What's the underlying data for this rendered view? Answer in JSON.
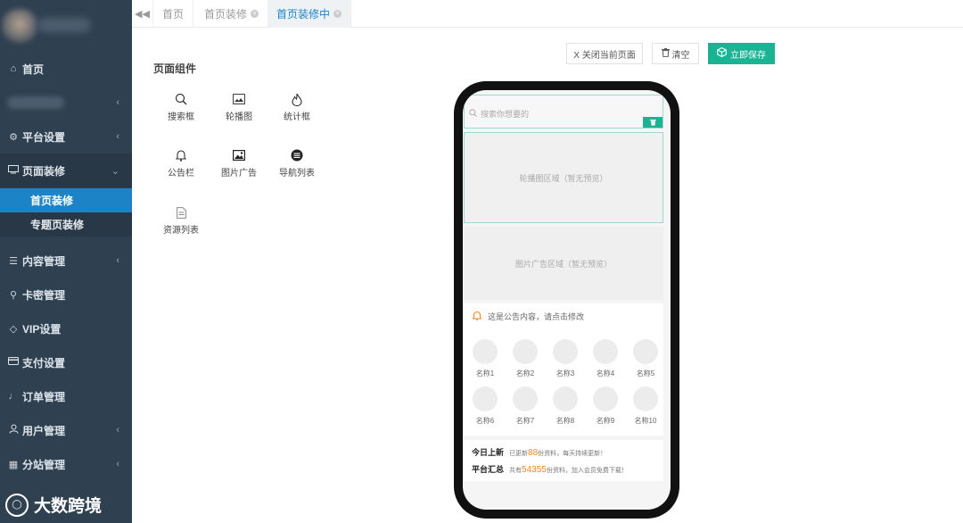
{
  "sidebar": {
    "items": [
      {
        "label": "首页",
        "icon": "home-icon"
      },
      {
        "label": "平台设置",
        "icon": "gear-icon"
      },
      {
        "label": "页面装修",
        "icon": "monitor-icon"
      },
      {
        "label": "内容管理",
        "icon": "database-icon"
      },
      {
        "label": "卡密管理",
        "icon": "key-icon"
      },
      {
        "label": "VIP设置",
        "icon": "diamond-icon"
      },
      {
        "label": "支付设置",
        "icon": "credit-card-icon"
      },
      {
        "label": "订单管理",
        "icon": "bell-icon"
      },
      {
        "label": "用户管理",
        "icon": "user-icon"
      },
      {
        "label": "分站管理",
        "icon": "sitemap-icon"
      }
    ],
    "sub_items": [
      "首页装修",
      "专题页装修"
    ]
  },
  "tabs": [
    {
      "label": "首页"
    },
    {
      "label": "首页装修"
    },
    {
      "label": "首页装修中"
    }
  ],
  "panel": {
    "title": "页面组件",
    "components": [
      {
        "label": "搜索框",
        "icon": "search-icon"
      },
      {
        "label": "轮播图",
        "icon": "carousel-icon"
      },
      {
        "label": "统计框",
        "icon": "fire-icon"
      },
      {
        "label": "公告栏",
        "icon": "bell-icon"
      },
      {
        "label": "图片广告",
        "icon": "image-icon"
      },
      {
        "label": "导航列表",
        "icon": "list-icon"
      },
      {
        "label": "资源列表",
        "icon": "file-icon"
      }
    ]
  },
  "toolbar": {
    "close_label": "X 关闭当前页面",
    "clear_label": "清空",
    "save_label": "立即保存"
  },
  "preview": {
    "search_placeholder": "搜索你想要的",
    "carousel_text": "轮播图区域（暂无预览）",
    "imgad_text": "图片广告区域（暂无预览）",
    "notice_text": "这是公告内容，请点击修改",
    "nav_items": [
      "名称1",
      "名称2",
      "名称3",
      "名称4",
      "名称5",
      "名称6",
      "名称7",
      "名称8",
      "名称9",
      "名称10"
    ],
    "stats": {
      "today_label": "今日上新",
      "today_prefix": "已更新",
      "today_num": "88",
      "today_suffix": "份资料，每天持续更新！",
      "total_label": "平台汇总",
      "total_prefix": "共有",
      "total_num": "54355",
      "total_suffix": "份资料，加入会员免费下载！"
    }
  },
  "watermark": {
    "text": "大数跨境"
  },
  "colors": {
    "sidebar_bg": "#2f4050",
    "active_blue": "#1c84c6",
    "primary_green": "#1ab394",
    "accent_orange": "#f08a24"
  }
}
